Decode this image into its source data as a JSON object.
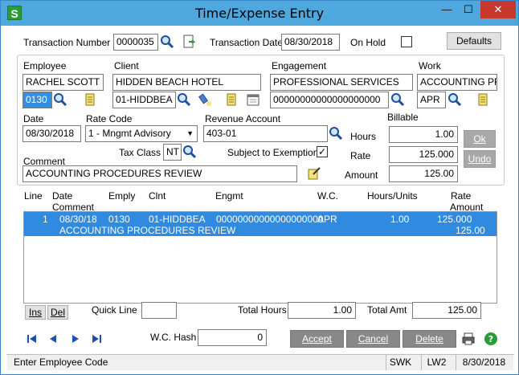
{
  "window": {
    "title": "Time/Expense Entry",
    "minimize": "—",
    "maximize": "☐",
    "close": "✕",
    "app_icon": "S"
  },
  "header": {
    "transaction_number_label": "Transaction Number",
    "transaction_number": "0000035",
    "transaction_date_label": "Transaction Date",
    "transaction_date": "08/30/2018",
    "on_hold_label": "On Hold",
    "defaults_label": "Defaults"
  },
  "employee": {
    "label": "Employee",
    "name": "RACHEL SCOTT",
    "code": "0130"
  },
  "client": {
    "label": "Client",
    "name": "HIDDEN BEACH HOTEL",
    "code": "01-HIDDBEA"
  },
  "engagement": {
    "label": "Engagement",
    "name": "PROFESSIONAL SERVICES",
    "code": "00000000000000000000"
  },
  "work": {
    "label": "Work",
    "name": "ACCOUNTING PROC",
    "code": "APR"
  },
  "details": {
    "date_label": "Date",
    "date": "08/30/2018",
    "rate_code_label": "Rate Code",
    "rate_code": "1 - Mngmt Advisory",
    "revenue_account_label": "Revenue Account",
    "revenue_account": "403-01",
    "tax_class_label": "Tax Class",
    "tax_class": "NT",
    "subject_to_exemption_label": "Subject to Exemption",
    "comment_label": "Comment",
    "comment": "ACCOUNTING PROCEDURES REVIEW",
    "billable_label": "Billable",
    "hours_label": "Hours",
    "hours": "1.00",
    "rate_label": "Rate",
    "rate": "125.000",
    "amount_label": "Amount",
    "amount": "125.00",
    "ok_label": "Ok",
    "undo_label": "Undo"
  },
  "grid": {
    "headers": {
      "line": "Line",
      "date": "Date",
      "comment": "Comment",
      "emply": "Emply",
      "clnt": "Clnt",
      "engmt": "Engmt",
      "wc": "W.C.",
      "hours_units": "Hours/Units",
      "rate": "Rate",
      "amount": "Amount"
    },
    "rows": [
      {
        "line": "1",
        "date": "08/30/18",
        "emply": "0130",
        "clnt": "01-HIDDBEA",
        "engmt": "00000000000000000000",
        "wc": "APR",
        "hours": "1.00",
        "rate": "125.000",
        "comment": "ACCOUNTING PROCEDURES REVIEW",
        "amount": "125.00"
      }
    ]
  },
  "footer": {
    "ins_label": "Ins",
    "del_label": "Del",
    "quick_line_label": "Quick Line",
    "quick_line": "",
    "total_hours_label": "Total Hours",
    "total_hours": "1.00",
    "total_amt_label": "Total Amt",
    "total_amt": "125.00",
    "wc_hash_label": "W.C. Hash",
    "wc_hash": "0",
    "accept_label": "Accept",
    "cancel_label": "Cancel",
    "delete_label": "Delete"
  },
  "status": {
    "message": "Enter Employee Code",
    "company": "SWK",
    "server": "LW2",
    "date": "8/30/2018"
  },
  "colors": {
    "title_bar": "#4ea8dd",
    "selection": "#2f8ae0",
    "close": "#c7382c"
  }
}
